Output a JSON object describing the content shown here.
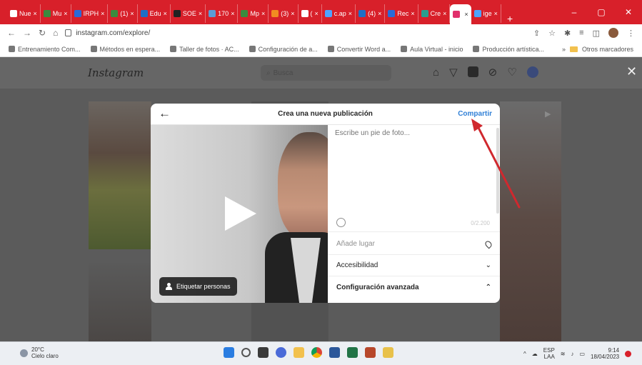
{
  "browser": {
    "tabs": [
      {
        "label": "Nue",
        "color": "#ffffff"
      },
      {
        "label": "Mu",
        "color": "#3b8a3e"
      },
      {
        "label": "IRPH",
        "color": "#2a6ad8"
      },
      {
        "label": "(1)",
        "color": "#3b8a3e"
      },
      {
        "label": "Edu",
        "color": "#1f6fc5"
      },
      {
        "label": "SOE",
        "color": "#222222"
      },
      {
        "label": "170",
        "color": "#5b9bd5"
      },
      {
        "label": "Mp",
        "color": "#3b8a3e"
      },
      {
        "label": "(3)",
        "color": "#f28b21"
      },
      {
        "label": "(",
        "color": "#ffffff"
      },
      {
        "label": "c.ap",
        "color": "#4da3ff"
      },
      {
        "label": "(4)",
        "color": "#1f6fc5"
      },
      {
        "label": "Rec",
        "color": "#2a6ad8"
      },
      {
        "label": "Cre",
        "color": "#2a9d8f"
      },
      {
        "label": "",
        "color": "#e1306c",
        "active": true
      },
      {
        "label": "ige",
        "color": "#4da3ff"
      }
    ],
    "new_tab": "+",
    "window_controls": [
      "–",
      "▢",
      "✕"
    ],
    "url": "instagram.com/explore/",
    "bookmarks": [
      "Entrenamiento Com...",
      "Métodos en espera...",
      "Taller de fotos · AC...",
      "Configuración de a...",
      "Convertir Word a...",
      "Aula Virtual - inicio",
      "Producción artística..."
    ],
    "bookmarks_folder": "Otros marcadores"
  },
  "instagram": {
    "logo": "Instagram",
    "search_placeholder": "Busca",
    "close": "✕"
  },
  "modal": {
    "title": "Crea una nueva publicación",
    "back": "←",
    "share": "Compartir",
    "caption_placeholder": "Escribe un pie de foto...",
    "char_counter": "0/2.200",
    "tag_people": "Etiquetar personas",
    "add_location": "Añade lugar",
    "accessibility": "Accesibilidad",
    "advanced_settings": "Configuración avanzada"
  },
  "taskbar": {
    "weather_temp": "20°C",
    "weather_desc": "Cielo claro",
    "lang": "ESP",
    "lang_region": "LAA",
    "time": "9:14",
    "date": "18/04/2023"
  },
  "colors": {
    "chrome_red": "#d8202a",
    "link_blue": "#2f7fd6",
    "annotation_red": "#d0282e"
  }
}
